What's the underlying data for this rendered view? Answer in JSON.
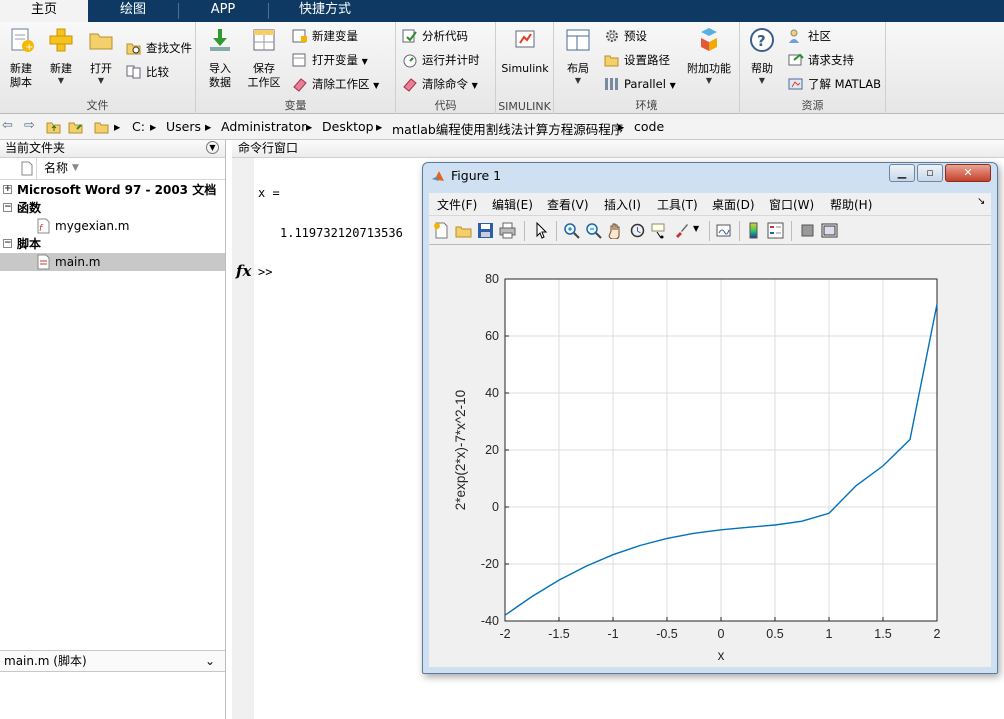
{
  "tabs": [
    {
      "label": "主页",
      "active": true
    },
    {
      "label": "绘图",
      "active": false
    },
    {
      "label": "APP",
      "active": false
    },
    {
      "label": "快捷方式",
      "active": false
    }
  ],
  "ribbon": {
    "file_group": {
      "label": "文件",
      "new_script": "新建\n脚本",
      "new": "新建",
      "open": "打开",
      "find_files": "查找文件",
      "compare": "比较"
    },
    "variable_group": {
      "label": "变量",
      "import_data": "导入\n数据",
      "save_workspace": "保存\n工作区",
      "new_variable": "新建变量",
      "open_variable": "打开变量",
      "clear_workspace": "清除工作区"
    },
    "code_group": {
      "label": "代码",
      "analyze_code": "分析代码",
      "run_and_time": "运行并计时",
      "clear_commands": "清除命令"
    },
    "simulink_group": {
      "label": "SIMULINK",
      "simulink": "Simulink"
    },
    "environment_group": {
      "label": "环境",
      "layout": "布局",
      "preferences": "预设",
      "set_path": "设置路径",
      "parallel": "Parallel",
      "addons": "附加功能"
    },
    "resources_group": {
      "label": "资源",
      "help": "帮助",
      "community": "社区",
      "request_support": "请求支持",
      "learn_matlab": "了解 MATLAB"
    }
  },
  "address": {
    "crumbs": [
      "C:",
      "Users",
      "Administrator",
      "Desktop",
      "matlab编程使用割线法计算方程源码程序",
      "code"
    ]
  },
  "current_folder": {
    "title": "当前文件夹",
    "column_name": "名称",
    "rows": [
      {
        "label": "Microsoft Word 97 - 2003 文档",
        "type": "group"
      },
      {
        "label": "函数",
        "type": "group"
      },
      {
        "label": "mygexian.m",
        "type": "file"
      },
      {
        "label": "脚本",
        "type": "group"
      },
      {
        "label": "main.m",
        "type": "file",
        "selected": true
      }
    ],
    "details_label": "main.m  (脚本)"
  },
  "command_window": {
    "title": "命令行窗口",
    "output_var": "x =",
    "output_value": "1.119732120713536",
    "prompt": ">>",
    "fx_label": "fx"
  },
  "figure": {
    "title": "Figure 1",
    "window_buttons": [
      "minimize",
      "maximize",
      "close"
    ],
    "menu": [
      "文件(F)",
      "编辑(E)",
      "查看(V)",
      "插入(I)",
      "工具(T)",
      "桌面(D)",
      "窗口(W)",
      "帮助(H)"
    ],
    "toolbar_icons": [
      "new-figure-icon",
      "open-file-icon",
      "save-icon",
      "print-icon",
      "pointer-icon",
      "zoom-in-icon",
      "zoom-out-icon",
      "pan-icon",
      "rotate-icon",
      "data-cursor-icon",
      "brush-icon",
      "link-plot-icon",
      "colorbar-icon",
      "legend-icon",
      "hide-plot-tools-icon",
      "show-plot-tools-icon"
    ]
  },
  "chart_data": {
    "type": "line",
    "title": "",
    "xlabel": "x",
    "ylabel": "2*exp(2*x)-7*x^2-10",
    "xlim": [
      -2,
      2
    ],
    "ylim": [
      -40,
      80
    ],
    "xticks": [
      -2,
      -1.5,
      -1,
      -0.5,
      0,
      0.5,
      1,
      1.5,
      2
    ],
    "yticks": [
      -40,
      -20,
      0,
      20,
      40,
      60,
      80
    ],
    "grid": true,
    "series": [
      {
        "color": "#0072bd",
        "x": [
          -2,
          -1.75,
          -1.5,
          -1.25,
          -1,
          -0.75,
          -0.5,
          -0.25,
          0,
          0.25,
          0.5,
          0.75,
          1,
          1.25,
          1.5,
          1.75,
          2
        ],
        "y": [
          -37.96,
          -31.4,
          -25.65,
          -20.78,
          -16.73,
          -13.5,
          -11.01,
          -9.22,
          -8,
          -7.14,
          -6.32,
          -4.97,
          -2.22,
          7.43,
          14.42,
          23.68,
          71.2
        ]
      }
    ]
  }
}
